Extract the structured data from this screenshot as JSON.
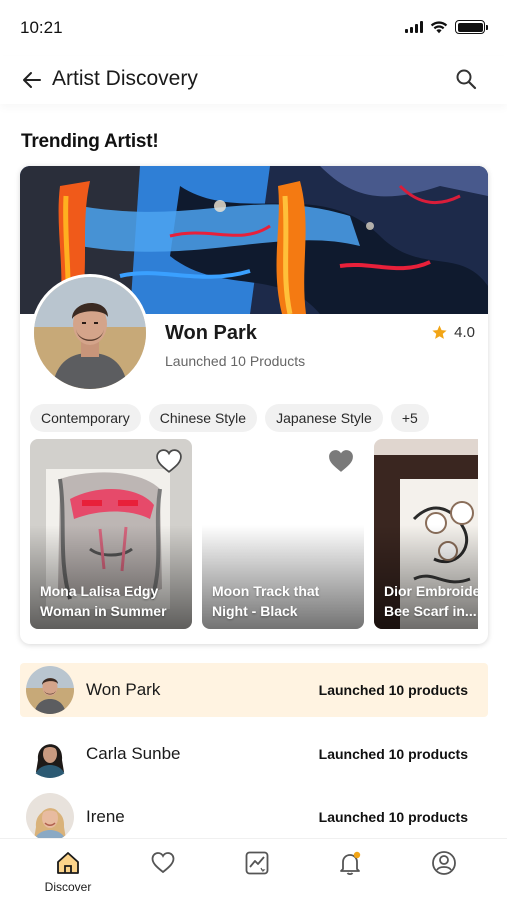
{
  "status_bar": {
    "time": "10:21"
  },
  "app_bar": {
    "title": "Artist Discovery"
  },
  "section": {
    "title": "Trending Artist!"
  },
  "trending": {
    "name": "Won Park",
    "subtitle": "Launched 10 Products",
    "rating": "4.0",
    "tags": [
      "Contemporary",
      "Chinese Style",
      "Japanese Style",
      "+5"
    ],
    "products": [
      {
        "title": "Mona Lalisa Edgy\nWoman in Summer",
        "liked": false
      },
      {
        "title": "Moon Track that\nNight - Black",
        "liked": false
      },
      {
        "title": "Dior Embroide\nBee Scarf in...",
        "liked": false
      }
    ]
  },
  "artists": [
    {
      "name": "Won Park",
      "count": "Launched 10 products",
      "selected": true
    },
    {
      "name": "Carla Sunbe",
      "count": "Launched 10 products",
      "selected": false
    },
    {
      "name": "Irene",
      "count": "Launched 10 products",
      "selected": false
    }
  ],
  "bottom_nav": {
    "items": [
      {
        "icon": "home-icon",
        "label": "Discover",
        "active": true
      },
      {
        "icon": "heart-icon",
        "label": ""
      },
      {
        "icon": "chart-icon",
        "label": ""
      },
      {
        "icon": "bell-icon",
        "label": ""
      },
      {
        "icon": "profile-icon",
        "label": ""
      }
    ]
  },
  "colors": {
    "accent": "#f2a516",
    "selected_row": "#fff3e1",
    "star": "#f2a516"
  }
}
